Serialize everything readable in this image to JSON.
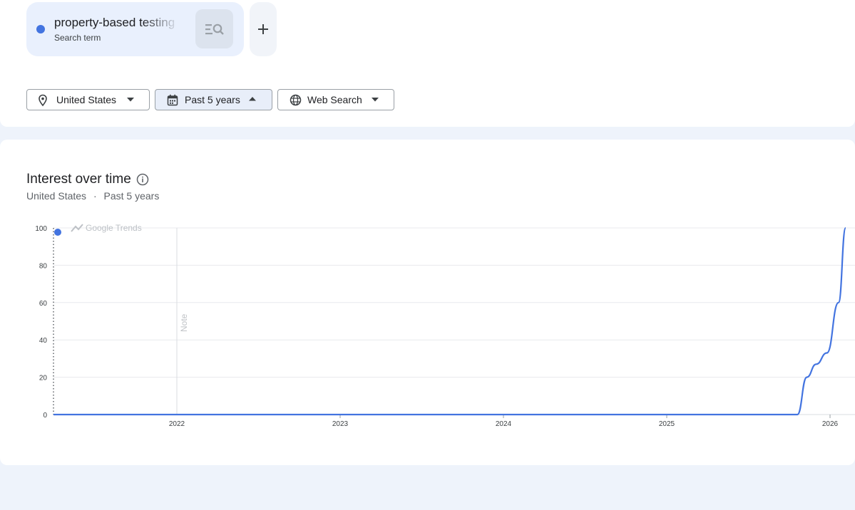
{
  "search_terms": [
    {
      "term": "property-based testing",
      "type_label": "Search term",
      "color": "#4374e0"
    }
  ],
  "filters": {
    "location": "United States",
    "time_range": "Past 5 years",
    "search_type": "Web Search"
  },
  "chart_section": {
    "title": "Interest over time",
    "subtitle_location": "United States",
    "subtitle_separator": "·",
    "subtitle_range": "Past 5 years",
    "watermark": "Google Trends",
    "note_label": "Note"
  },
  "chart_data": {
    "type": "line",
    "title": "Interest over time",
    "xlabel": "",
    "ylabel": "",
    "ylim": [
      0,
      100
    ],
    "yticks": [
      0,
      20,
      40,
      60,
      80,
      100
    ],
    "xticks": [
      "2022",
      "2023",
      "2024",
      "2025",
      "2026"
    ],
    "grid": true,
    "legend": "none",
    "series": [
      {
        "name": "property-based testing",
        "color": "#4374e0",
        "points": [
          {
            "x": "2021-04-01",
            "y": 0
          },
          {
            "x": "2022-01-01",
            "y": 0
          },
          {
            "x": "2023-01-01",
            "y": 0
          },
          {
            "x": "2024-01-01",
            "y": 0
          },
          {
            "x": "2025-01-01",
            "y": 0
          },
          {
            "x": "2025-10-20",
            "y": 0
          },
          {
            "x": "2025-11-10",
            "y": 20
          },
          {
            "x": "2025-12-01",
            "y": 27
          },
          {
            "x": "2025-12-25",
            "y": 33
          },
          {
            "x": "2026-01-20",
            "y": 60
          },
          {
            "x": "2026-02-05",
            "y": 100
          }
        ]
      }
    ]
  }
}
